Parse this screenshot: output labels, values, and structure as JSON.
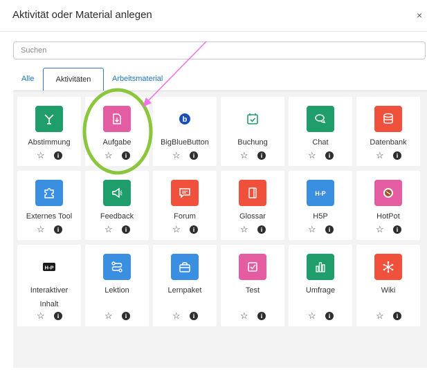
{
  "dialog": {
    "title": "Aktivität oder Material anlegen",
    "close_label": "×"
  },
  "search": {
    "placeholder": "Suchen",
    "value": ""
  },
  "tabs": [
    {
      "label": "Alle",
      "active": false
    },
    {
      "label": "Aktivitäten",
      "active": true
    },
    {
      "label": "Arbeitsmaterial",
      "active": false
    }
  ],
  "items": [
    {
      "label": "Abstimmung",
      "icon": "poll-icon",
      "color": "#1f9d6b"
    },
    {
      "label": "Aufgabe",
      "icon": "assignment-icon",
      "color": "#e45ca1"
    },
    {
      "label": "BigBlueButton",
      "icon": "bigbluebutton-icon",
      "color": "#ffffff"
    },
    {
      "label": "Buchung",
      "icon": "calendar-icon",
      "color": "#ffffff"
    },
    {
      "label": "Chat",
      "icon": "chat-icon",
      "color": "#1f9d6b"
    },
    {
      "label": "Datenbank",
      "icon": "database-icon",
      "color": "#f0513c"
    },
    {
      "label": "Externes Tool",
      "icon": "puzzle-icon",
      "color": "#3b8fe0"
    },
    {
      "label": "Feedback",
      "icon": "megaphone-icon",
      "color": "#1f9d6b"
    },
    {
      "label": "Forum",
      "icon": "forum-icon",
      "color": "#f0513c"
    },
    {
      "label": "Glossar",
      "icon": "book-icon",
      "color": "#f0513c"
    },
    {
      "label": "H5P",
      "icon": "h5p-icon",
      "color": "#3b8fe0"
    },
    {
      "label": "HotPot",
      "icon": "hotpot-icon",
      "color": "#e45ca1"
    },
    {
      "label": "Interaktiver Inhalt",
      "icon": "h5p-dark-icon",
      "color": "#ffffff"
    },
    {
      "label": "Lektion",
      "icon": "lesson-icon",
      "color": "#3b8fe0"
    },
    {
      "label": "Lernpaket",
      "icon": "package-icon",
      "color": "#3b8fe0"
    },
    {
      "label": "Test",
      "icon": "quiz-icon",
      "color": "#e45ca1"
    },
    {
      "label": "Umfrage",
      "icon": "survey-icon",
      "color": "#1f9d6b"
    },
    {
      "label": "Wiki",
      "icon": "wiki-icon",
      "color": "#f0513c"
    }
  ],
  "annotation": {
    "arrow_color": "#f472e8",
    "circle_color": "#8cc63f"
  }
}
